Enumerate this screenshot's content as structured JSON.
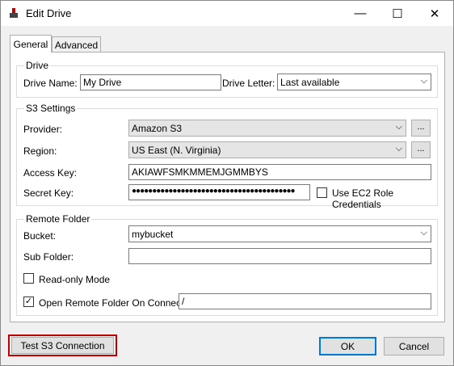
{
  "window": {
    "title": "Edit Drive",
    "minimize": "—",
    "maximize": "☐",
    "close": "✕"
  },
  "tabs": [
    {
      "label": "General",
      "active": true
    },
    {
      "label": "Advanced",
      "active": false
    }
  ],
  "drive": {
    "group_label": "Drive",
    "name_label": "Drive Name:",
    "name_value": "My Drive",
    "letter_label": "Drive Letter:",
    "letter_value": "Last available"
  },
  "s3": {
    "group_label": "S3 Settings",
    "provider_label": "Provider:",
    "provider_value": "Amazon S3",
    "region_label": "Region:",
    "region_value": "US East (N. Virginia)",
    "access_key_label": "Access Key:",
    "access_key_value": "AKIAWFSMKMMEMJGMMBYS",
    "secret_key_label": "Secret Key:",
    "secret_key_value": "●●●●●●●●●●●●●●●●●●●●●●●●●●●●●●●●●●●●●●●●",
    "ec2_label": "Use EC2 Role Credentials",
    "ec2_checked": false,
    "browse": "..."
  },
  "remote": {
    "group_label": "Remote Folder",
    "bucket_label": "Bucket:",
    "bucket_value": "mybucket",
    "subfolder_label": "Sub Folder:",
    "subfolder_value": "",
    "readonly_label": "Read-only Mode",
    "readonly_checked": false,
    "open_label": "Open Remote Folder On Connect:",
    "open_checked": true,
    "open_value": "/"
  },
  "buttons": {
    "test": "Test S3 Connection",
    "ok": "OK",
    "cancel": "Cancel"
  }
}
